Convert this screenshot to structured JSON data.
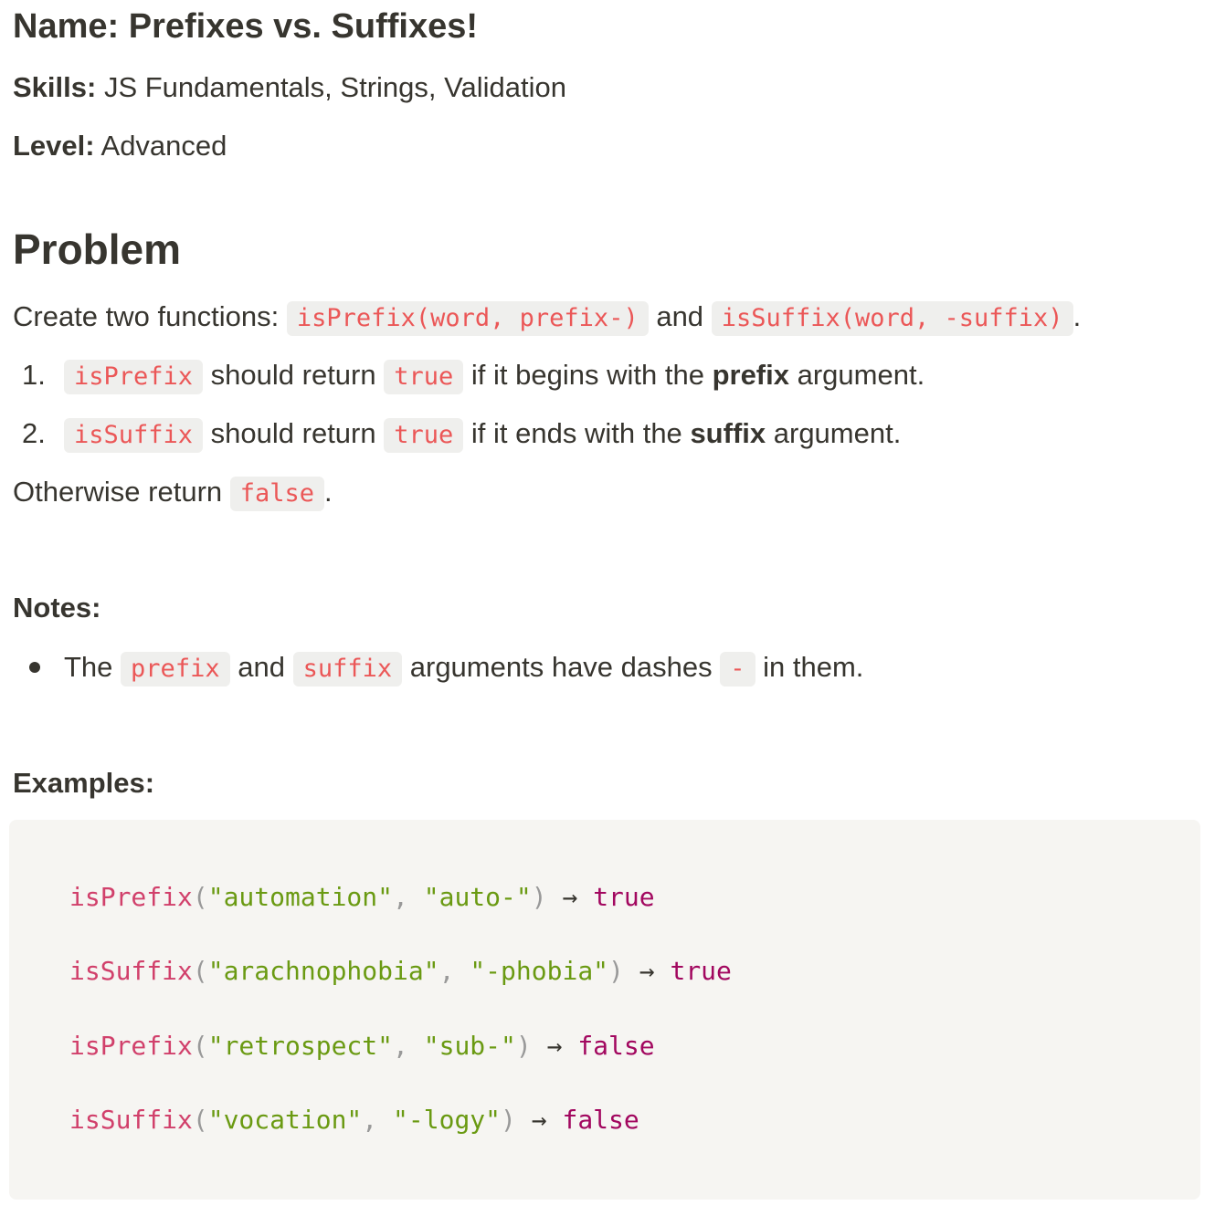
{
  "header": {
    "name_label": "Name:",
    "name_value": "Prefixes vs. Suffixes!",
    "skills_label": "Skills:",
    "skills_value": "JS Fundamentals, Strings, Validation",
    "level_label": "Level:",
    "level_value": "Advanced"
  },
  "problem": {
    "heading": "Problem",
    "intro_text": "Create two functions:",
    "intro_code1": "isPrefix(word, prefix-)",
    "intro_and": "and",
    "intro_code2": "isSuffix(word, -suffix)",
    "intro_end": ".",
    "items": [
      {
        "number": "1.",
        "code": "isPrefix",
        "text1": "should return",
        "value": "true",
        "text2": "if it begins with the",
        "bold": "prefix",
        "text3": "argument."
      },
      {
        "number": "2.",
        "code": "isSuffix",
        "text1": "should return",
        "value": "true",
        "text2": "if it ends with the",
        "bold": "suffix",
        "text3": "argument."
      }
    ],
    "otherwise_text": "Otherwise return",
    "otherwise_code": "false",
    "otherwise_end": "."
  },
  "notes": {
    "heading": "Notes:",
    "bullet": {
      "text1": "The",
      "code1": "prefix",
      "text2": "and",
      "code2": "suffix",
      "text3": "arguments have dashes",
      "code3": "-",
      "text4": "in them."
    }
  },
  "examples": {
    "heading": "Examples:",
    "lines": [
      {
        "fn": "isPrefix",
        "open": "(",
        "arg1": "\"automation\"",
        "comma": ", ",
        "arg2": "\"auto-\"",
        "close": ")",
        "arrow": " → ",
        "result": "true"
      },
      {
        "fn": "isSuffix",
        "open": "(",
        "arg1": "\"arachnophobia\"",
        "comma": ", ",
        "arg2": "\"-phobia\"",
        "close": ")",
        "arrow": " → ",
        "result": "true"
      },
      {
        "fn": "isPrefix",
        "open": "(",
        "arg1": "\"retrospect\"",
        "comma": ", ",
        "arg2": "\"sub-\"",
        "close": ")",
        "arrow": " → ",
        "result": "false"
      },
      {
        "fn": "isSuffix",
        "open": "(",
        "arg1": "\"vocation\"",
        "comma": ", ",
        "arg2": "\"-logy\"",
        "close": ")",
        "arrow": " → ",
        "result": "false"
      }
    ]
  },
  "colors": {
    "text": "#37352f",
    "inline_code": "#eb5757",
    "inline_code_bg": "#efefed",
    "codeblock_bg": "#f6f5f2",
    "fn_name": "#d1406b",
    "string": "#6a9a12",
    "keyword": "#a2075f"
  }
}
